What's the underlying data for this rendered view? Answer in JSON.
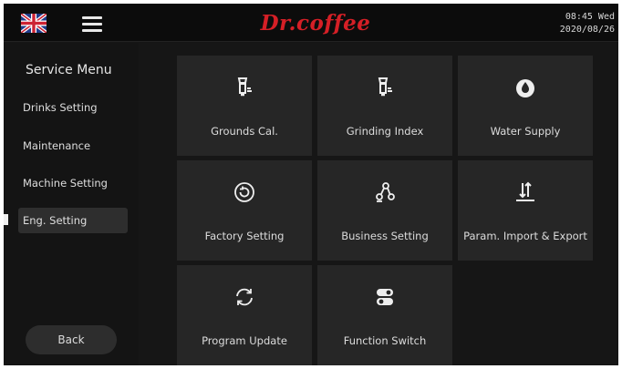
{
  "header": {
    "brand": "Dr.coffee",
    "time": "08:45 Wed",
    "date": "2020/08/26",
    "language_icon": "uk-flag-icon",
    "menu_icon": "hamburger-menu-icon"
  },
  "sidebar": {
    "title": "Service Menu",
    "items": [
      {
        "label": "Drinks Setting",
        "active": false
      },
      {
        "label": "Maintenance",
        "active": false
      },
      {
        "label": "Machine Setting",
        "active": false
      },
      {
        "label": "Eng. Setting",
        "active": true
      }
    ],
    "back_label": "Back"
  },
  "tiles": [
    {
      "label": "Grounds Cal.",
      "icon": "grinder-icon"
    },
    {
      "label": "Grinding Index",
      "icon": "grinder-icon"
    },
    {
      "label": "Water Supply",
      "icon": "water-drop-icon"
    },
    {
      "label": "Factory Setting",
      "icon": "reset-icon"
    },
    {
      "label": "Business Setting",
      "icon": "business-nodes-icon"
    },
    {
      "label": "Param. Import & Export",
      "icon": "import-export-icon"
    },
    {
      "label": "Program Update",
      "icon": "refresh-icon"
    },
    {
      "label": "Function Switch",
      "icon": "toggle-switch-icon"
    }
  ],
  "colors": {
    "brand": "#d51f26",
    "background": "#151515",
    "tile": "#262626",
    "text": "#dcdcdc"
  }
}
